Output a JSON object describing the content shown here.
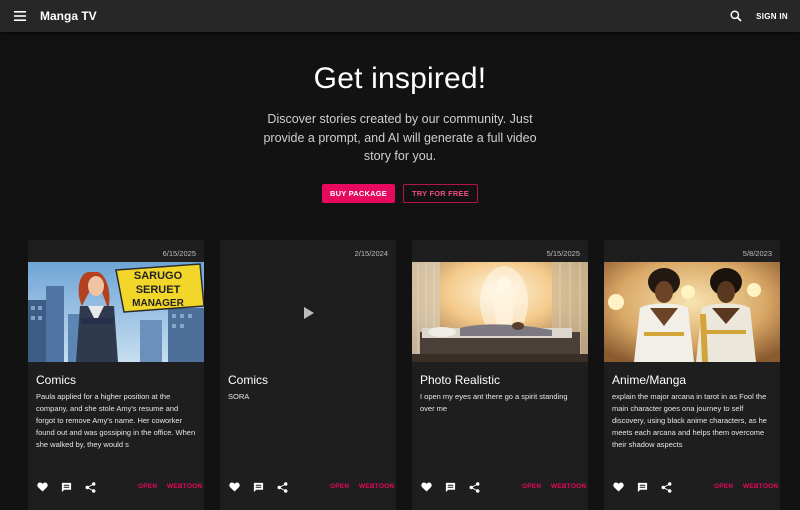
{
  "header": {
    "title": "Manga TV",
    "menu_icon": "menu-icon",
    "search_icon": "search-icon",
    "sign_in": "SIGN IN"
  },
  "hero": {
    "heading": "Get inspired!",
    "text": "Discover stories created by our community. Just provide a prompt, and AI will generate a full video story for you.",
    "buy_package": "BUY PACKAGE",
    "try_free": "TRY FOR FREE"
  },
  "cards": [
    {
      "date": "6/15/2025",
      "title": "Comics",
      "desc": "Paula applied for a higher position at the company, and she stole Amy's resume and forgot to remove Amy's name. Her coworker found out and was gossiping in the office. When she walked by, they would s",
      "art_text_1": "SARUGO",
      "art_text_2": "SERUET",
      "art_text_3": "MANAGER",
      "open": "OPEN",
      "webtoon": "WEBTOON"
    },
    {
      "date": "2/15/2024",
      "title": "Comics",
      "desc": "SORA",
      "open": "OPEN",
      "webtoon": "WEBTOON"
    },
    {
      "date": "5/15/2025",
      "title": "Photo Realistic",
      "desc": "I open my eyes ant there go a spirit standing over me",
      "open": "OPEN",
      "webtoon": "WEBTOON"
    },
    {
      "date": "5/8/2023",
      "title": "Anime/Manga",
      "desc": "explain the major arcana in tarot in as Fool the main character goes ona journey to self discovery, using black anime characters, as he meets each arcana and helps them overcome their shadow aspects",
      "open": "OPEN",
      "webtoon": "WEBTOON"
    }
  ],
  "colors": {
    "accent": "#e6095d",
    "background": "#121212",
    "card": "#1e1e1e",
    "appbar": "#272727"
  }
}
